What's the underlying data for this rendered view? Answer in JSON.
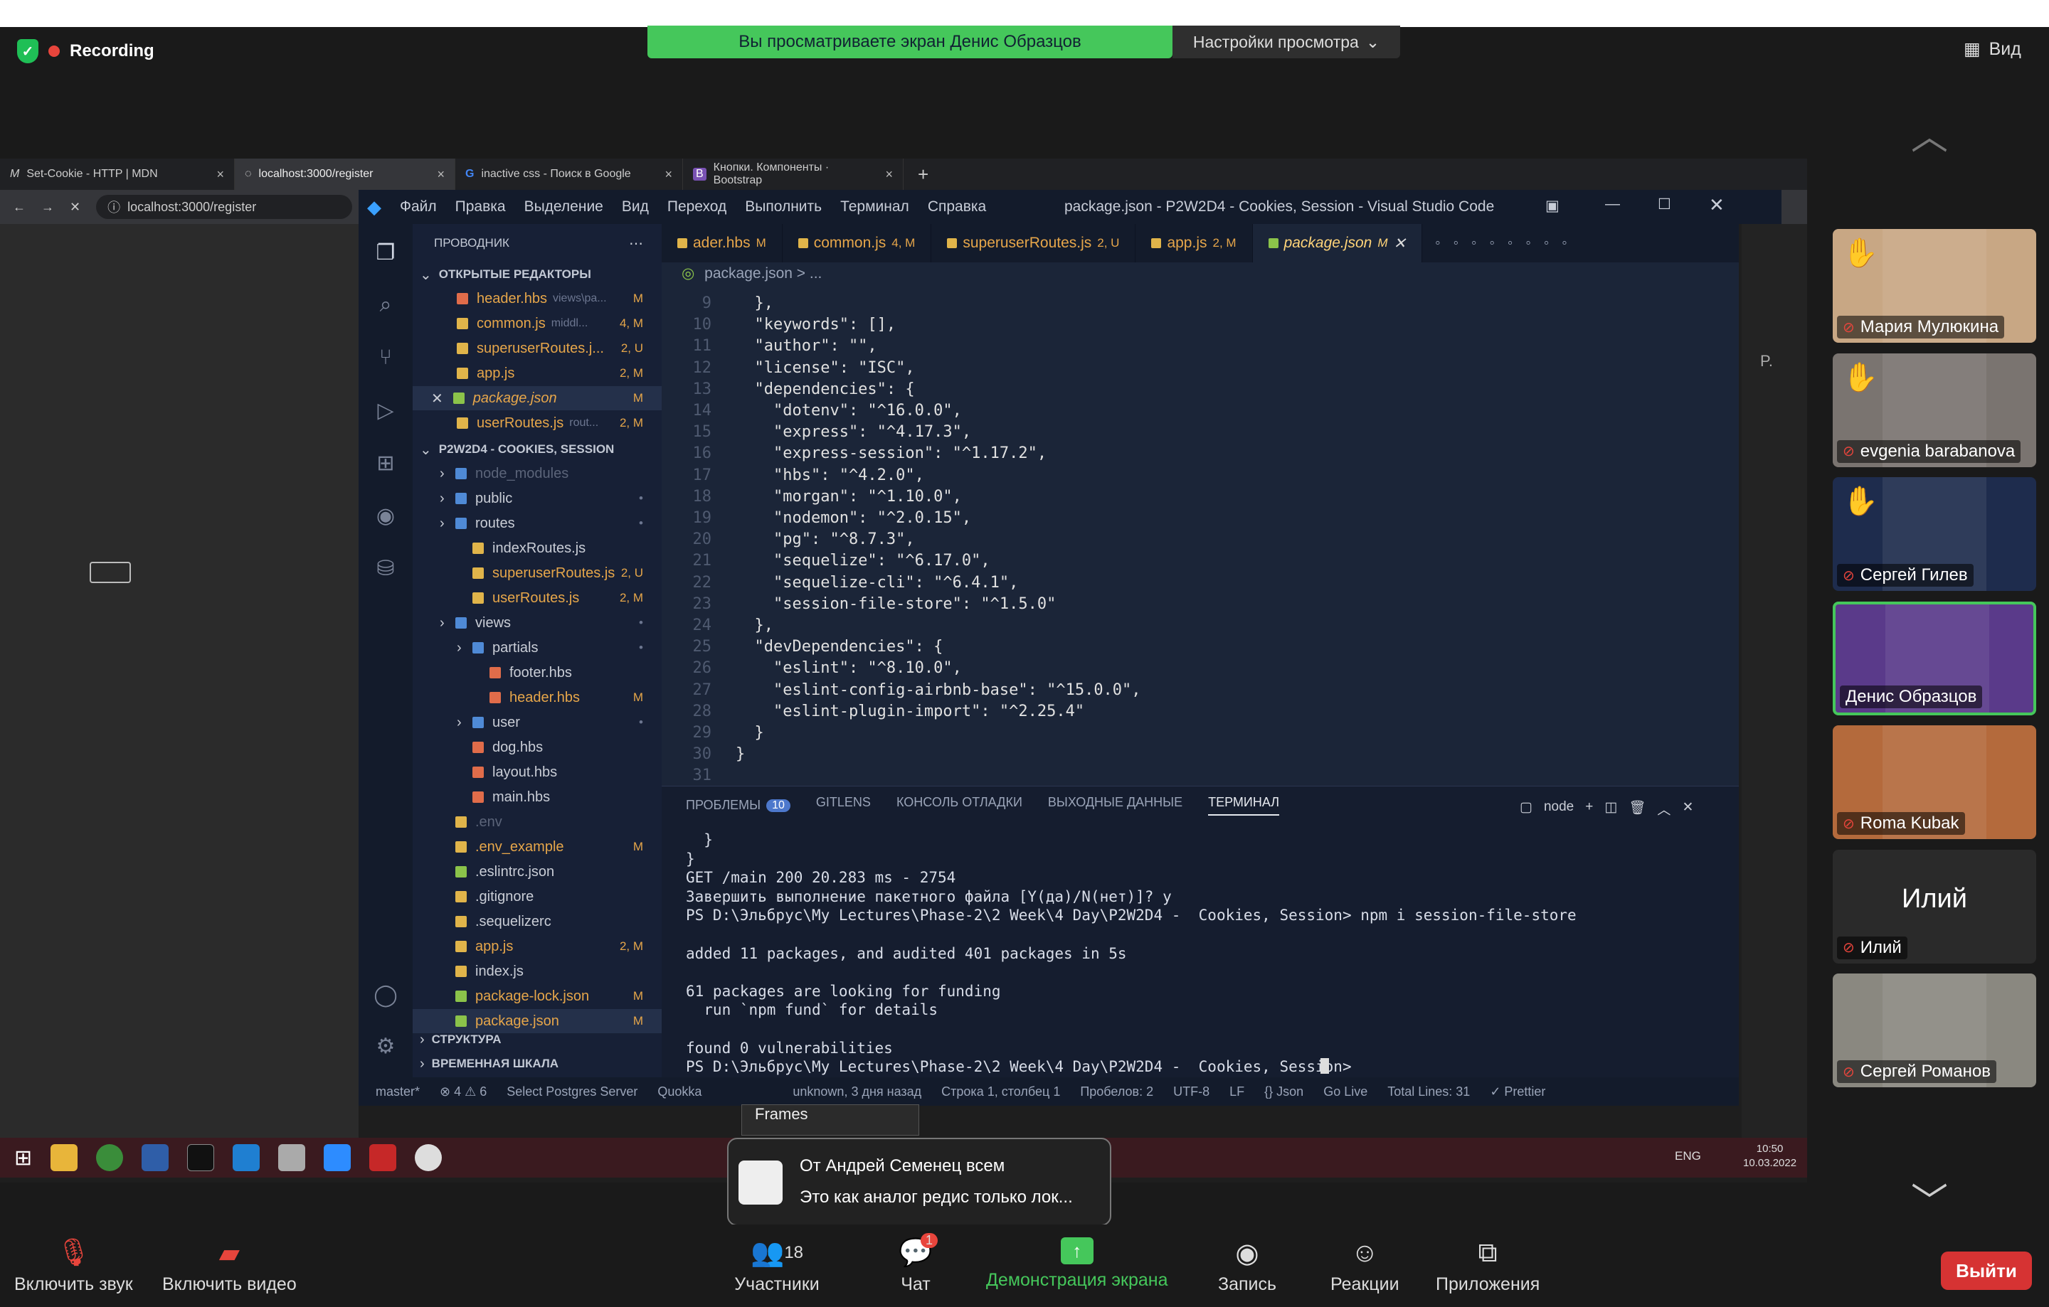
{
  "zoom": {
    "recording": "Recording",
    "viewing_banner": "Вы просматриваете экран Денис Образцов",
    "view_settings": "Настройки просмотра",
    "view_button": "Вид",
    "participants_count": "18",
    "chat_badge": "1",
    "toolbar": {
      "unmute": "Включить звук",
      "start_video": "Включить видео",
      "participants": "Участники",
      "chat": "Чат",
      "share": "Демонстрация экрана",
      "record": "Запись",
      "reactions": "Реакции",
      "apps": "Приложения",
      "leave": "Выйти"
    },
    "participants": [
      {
        "name": "Мария Мулюкина",
        "hand": true,
        "bg": "#c8a784"
      },
      {
        "name": "evgenia barabanova",
        "hand": true,
        "bg": "#7a7470"
      },
      {
        "name": "Сергей Гилев",
        "hand": true,
        "bg": "#1e2c4d"
      },
      {
        "name": "Денис Образцов",
        "hand": false,
        "bg": "#5a3a8a"
      },
      {
        "name": "Roma Kubak",
        "hand": false,
        "bg": "#b46a3c"
      },
      {
        "name": "Илий",
        "hand": false,
        "bg": "#2a2a2a",
        "initials": "Илий"
      },
      {
        "name": "Сергей Романов",
        "hand": false,
        "bg": "#8a8880"
      }
    ],
    "toast": {
      "title": "От Андрей Семенец всем",
      "message": "Это как аналог редис только лок..."
    }
  },
  "browser": {
    "tabs": [
      {
        "label": "Set-Cookie - HTTP | MDN",
        "icon": "M"
      },
      {
        "label": "localhost:3000/register",
        "icon": "loading"
      },
      {
        "label": "inactive css - Поиск в Google",
        "icon": "G"
      },
      {
        "label": "Кнопки. Компоненты · Bootstrap",
        "icon": "B"
      }
    ],
    "url": "localhost:3000/register"
  },
  "vscode": {
    "menu": [
      "Файл",
      "Правка",
      "Выделение",
      "Вид",
      "Переход",
      "Выполнить",
      "Терминал",
      "Справка"
    ],
    "title": "package.json - P2W2D4 - Cookies, Session - Visual Studio Code",
    "explorer_title": "ПРОВОДНИК",
    "open_editors_header": "ОТКРЫТЫЕ РЕДАКТОРЫ",
    "open_editors": [
      {
        "name": "header.hbs",
        "hint": "views\\pa...",
        "badge": "M",
        "color": "#e06c4a"
      },
      {
        "name": "common.js",
        "hint": "middl...",
        "badge": "4, M",
        "color": "#e0b44a"
      },
      {
        "name": "superuserRoutes.j...",
        "hint": "",
        "badge": "2, U",
        "color": "#e0b44a"
      },
      {
        "name": "app.js",
        "hint": "",
        "badge": "2, M",
        "color": "#e0b44a"
      },
      {
        "name": "package.json",
        "hint": "",
        "badge": "M",
        "color": "#8bc34a"
      },
      {
        "name": "userRoutes.js",
        "hint": "rout...",
        "badge": "2, M",
        "color": "#e0b44a"
      }
    ],
    "project_header": "P2W2D4 - COOKIES, SESSION",
    "tree": [
      {
        "name": "node_modules",
        "badge": "",
        "indent": 1,
        "folder": true
      },
      {
        "name": "public",
        "badge": "•",
        "indent": 1,
        "folder": true
      },
      {
        "name": "routes",
        "badge": "•",
        "indent": 1,
        "folder": true
      },
      {
        "name": "indexRoutes.js",
        "badge": "",
        "indent": 2
      },
      {
        "name": "superuserRoutes.js",
        "badge": "2, U",
        "indent": 2
      },
      {
        "name": "userRoutes.js",
        "badge": "2, M",
        "indent": 2
      },
      {
        "name": "views",
        "badge": "•",
        "indent": 1,
        "folder": true
      },
      {
        "name": "partials",
        "badge": "•",
        "indent": 2,
        "folder": true
      },
      {
        "name": "footer.hbs",
        "badge": "",
        "indent": 3
      },
      {
        "name": "header.hbs",
        "badge": "M",
        "indent": 3
      },
      {
        "name": "user",
        "badge": "•",
        "indent": 2,
        "folder": true
      },
      {
        "name": "dog.hbs",
        "badge": "",
        "indent": 2
      },
      {
        "name": "layout.hbs",
        "badge": "",
        "indent": 2
      },
      {
        "name": "main.hbs",
        "badge": "",
        "indent": 2
      },
      {
        "name": ".env",
        "badge": "",
        "indent": 1
      },
      {
        "name": ".env_example",
        "badge": "M",
        "indent": 1
      },
      {
        "name": ".eslintrc.json",
        "badge": "",
        "indent": 1
      },
      {
        "name": ".gitignore",
        "badge": "",
        "indent": 1
      },
      {
        "name": ".sequelizerc",
        "badge": "",
        "indent": 1
      },
      {
        "name": "app.js",
        "badge": "2, M",
        "indent": 1
      },
      {
        "name": "index.js",
        "badge": "",
        "indent": 1
      },
      {
        "name": "package-lock.json",
        "badge": "M",
        "indent": 1
      },
      {
        "name": "package.json",
        "badge": "M",
        "indent": 1
      }
    ],
    "outline_header": "СТРУКТУРА",
    "timeline_header": "ВРЕМЕННАЯ ШКАЛА",
    "editor_tabs": [
      {
        "name": "ader.hbs",
        "badge": "M"
      },
      {
        "name": "common.js",
        "badge": "4, M"
      },
      {
        "name": "superuserRoutes.js",
        "badge": "2, U"
      },
      {
        "name": "app.js",
        "badge": "2, M"
      },
      {
        "name": "package.json",
        "badge": "M",
        "active": true
      }
    ],
    "breadcrumb": "package.json > ...",
    "code": [
      {
        "n": "9",
        "t": "  },"
      },
      {
        "n": "10",
        "t": "  \"keywords\": [],"
      },
      {
        "n": "11",
        "t": "  \"author\": \"\","
      },
      {
        "n": "12",
        "t": "  \"license\": \"ISC\","
      },
      {
        "n": "13",
        "t": "  \"dependencies\": {"
      },
      {
        "n": "14",
        "t": "    \"dotenv\": \"^16.0.0\","
      },
      {
        "n": "15",
        "t": "    \"express\": \"^4.17.3\","
      },
      {
        "n": "16",
        "t": "    \"express-session\": \"^1.17.2\","
      },
      {
        "n": "17",
        "t": "    \"hbs\": \"^4.2.0\","
      },
      {
        "n": "18",
        "t": "    \"morgan\": \"^1.10.0\","
      },
      {
        "n": "19",
        "t": "    \"nodemon\": \"^2.0.15\","
      },
      {
        "n": "20",
        "t": "    \"pg\": \"^8.7.3\","
      },
      {
        "n": "21",
        "t": "    \"sequelize\": \"^6.17.0\","
      },
      {
        "n": "22",
        "t": "    \"sequelize-cli\": \"^6.4.1\","
      },
      {
        "n": "23",
        "t": "    \"session-file-store\": \"^1.5.0\""
      },
      {
        "n": "24",
        "t": "  },"
      },
      {
        "n": "25",
        "t": "  \"devDependencies\": {"
      },
      {
        "n": "26",
        "t": "    \"eslint\": \"^8.10.0\","
      },
      {
        "n": "27",
        "t": "    \"eslint-config-airbnb-base\": \"^15.0.0\","
      },
      {
        "n": "28",
        "t": "    \"eslint-plugin-import\": \"^2.25.4\""
      },
      {
        "n": "29",
        "t": "  }"
      },
      {
        "n": "30",
        "t": "}"
      },
      {
        "n": "31",
        "t": ""
      }
    ],
    "panel_tabs": [
      "ПРОБЛЕМЫ",
      "GITLENS",
      "КОНСОЛЬ ОТЛАДКИ",
      "ВЫХОДНЫЕ ДАННЫЕ",
      "ТЕРМИНАЛ"
    ],
    "problems_count": "10",
    "terminal_name": "node",
    "terminal": [
      "  }",
      "}",
      "GET /main 200 20.283 ms - 2754",
      "Завершить выполнение пакетного файла [Y(да)/N(нет)]? y",
      "PS D:\\Эльбрус\\My Lectures\\Phase-2\\2 Week\\4 Day\\P2W2D4 -  Cookies, Session> npm i session-file-store",
      "",
      "added 11 packages, and audited 401 packages in 5s",
      "",
      "61 packages are looking for funding",
      "  run `npm fund` for details",
      "",
      "found 0 vulnerabilities",
      "PS D:\\Эльбрус\\My Lectures\\Phase-2\\2 Week\\4 Day\\P2W2D4 -  Cookies, Session> "
    ],
    "status": {
      "branch": "master*",
      "problems": "⊗ 4 ⚠ 6",
      "postgres": "Select Postgres Server",
      "quokka": "Quokka",
      "blame": "unknown, 3 дня назад",
      "position": "Строка 1, столбец 1",
      "spaces": "Пробелов: 2",
      "encoding": "UTF-8",
      "eol": "LF",
      "language": "{} Json",
      "golive": "Go Live",
      "lines": "Total Lines: 31",
      "prettier": "✓ Prettier"
    }
  },
  "taskbar": {
    "lang": "ENG",
    "time": "10:50",
    "date": "10.03.2022",
    "frames": "Frames"
  },
  "side": {
    "label_r": "P."
  }
}
